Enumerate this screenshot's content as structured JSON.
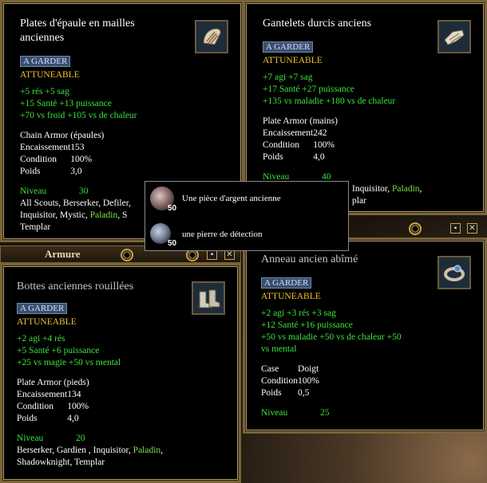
{
  "windows": {
    "shoulder": {
      "title_line1": "Plates d'épaule en mailles",
      "title_line2": "anciennes",
      "tag": "A GARDER",
      "attuneable": "ATTUNEABLE",
      "stats": [
        "+5 rés  +5 sag",
        "+15 Santé  +13 puissance",
        "+70 vs froid  +105 vs de chaleur"
      ],
      "armor_type": "Chain Armor (épaules)",
      "props": [
        {
          "k": "Encaissement",
          "v": "153"
        },
        {
          "k": "Condition",
          "v": "100%"
        },
        {
          "k": "Poids",
          "v": "3,0"
        }
      ],
      "level_label": "Niveau",
      "level": "30",
      "classes_line1": "All Scouts, Berserker, Defiler,",
      "classes_line2a": "Inquisitor, Mystic, ",
      "classes_line2_paladin": "Paladin",
      "classes_line2b": ", S",
      "classes_line3": "Templar",
      "icon": "shoulder-armor-icon"
    },
    "gauntlets": {
      "title": "Gantelets durcis anciens",
      "tag": "A GARDER",
      "attuneable": "ATTUNEABLE",
      "stats": [
        "+7 agi  +7 sag",
        "+17 Santé  +27 puissance",
        "+135 vs maladie  +180 vs de chaleur"
      ],
      "armor_type": "Plate Armor (mains)",
      "props": [
        {
          "k": "Encaissement",
          "v": "242"
        },
        {
          "k": "Condition",
          "v": "100%"
        },
        {
          "k": "Poids",
          "v": "4,0"
        }
      ],
      "level_label": "Niveau",
      "level": "40",
      "classes_line1a": "Inquisitor, ",
      "classes_line1_paladin": "Paladin",
      "classes_line1b": ",",
      "classes_line2": "plar",
      "icon": "gauntlet-icon"
    },
    "boots": {
      "titlebar": "Armure",
      "title": "Bottes anciennes rouillées",
      "tag": "A GARDER",
      "attuneable": "ATTUNEABLE",
      "stats": [
        "+2 agi  +4 rés",
        "+5 Santé  +6 puissance",
        "+25 vs magie  +50 vs mental"
      ],
      "armor_type": "Plate Armor (pieds)",
      "props": [
        {
          "k": "Encaissement",
          "v": "134"
        },
        {
          "k": "Condition",
          "v": "100%"
        },
        {
          "k": "Poids",
          "v": "4,0"
        }
      ],
      "level_label": "Niveau",
      "level": "20",
      "classes_line1a": "Berserker, Gardien , Inquisitor, ",
      "classes_line1_paladin": "Paladin",
      "classes_line1b": ",",
      "classes_line2": "Shadowknight, Templar",
      "icon": "boots-icon"
    },
    "ring": {
      "title": "Anneau ancien abîmé",
      "tag": "A GARDER",
      "attuneable": "ATTUNEABLE",
      "stats": [
        "+2 agi  +3 rés  +3 sag",
        "+12 Santé  +16 puissance",
        "+50 vs maladie  +50 vs de chaleur  +50",
        "vs mental"
      ],
      "props": [
        {
          "k": "Case",
          "v": "Doigt"
        },
        {
          "k": "Condition",
          "v": "100%"
        },
        {
          "k": "Poids",
          "v": "0,5"
        }
      ],
      "level_label": "Niveau",
      "level": "25",
      "icon": "ring-icon"
    }
  },
  "popup": {
    "items": [
      {
        "count": "50",
        "label": "Une pièce d'argent ancienne",
        "icon": "silver-coin-icon"
      },
      {
        "count": "50",
        "label": "une pierre de détection",
        "icon": "detection-stone-icon"
      }
    ]
  },
  "buttons": {
    "min": "▪",
    "close": "✕"
  }
}
